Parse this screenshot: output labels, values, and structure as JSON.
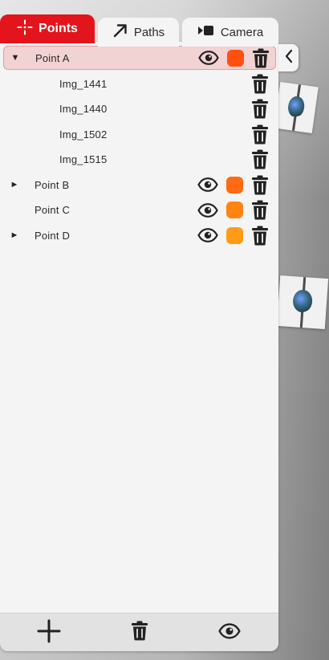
{
  "tabs": [
    {
      "label": "Points",
      "icon": "crosshair-icon",
      "active": true
    },
    {
      "label": "Paths",
      "icon": "arrow-up-right-icon",
      "active": false
    },
    {
      "label": "Camera",
      "icon": "camera-icon",
      "active": false
    }
  ],
  "collapse_icon": "chevron-left-icon",
  "points": [
    {
      "label": "Point A",
      "expanded": true,
      "selected": true,
      "color": "#ff5012"
    },
    {
      "label": "Point B",
      "expanded": false,
      "selected": false,
      "color": "#ff6a12"
    },
    {
      "label": "Point C",
      "expanded": null,
      "selected": false,
      "color": "#ff8412"
    },
    {
      "label": "Point D",
      "expanded": false,
      "selected": false,
      "color": "#ff9b14"
    }
  ],
  "images": [
    {
      "label": "Img_1441"
    },
    {
      "label": "Img_1440"
    },
    {
      "label": "Img_1502"
    },
    {
      "label": "Img_1515"
    }
  ],
  "bottom_bar": {
    "add_icon": "plus-icon",
    "delete_icon": "trash-icon",
    "visibility_icon": "eye-icon"
  },
  "colors": {
    "accent": "#e3141c",
    "panel_bg": "#f4f4f4",
    "selected_row_bg": "#f2d3d3",
    "selected_row_border": "#e59a9a"
  }
}
